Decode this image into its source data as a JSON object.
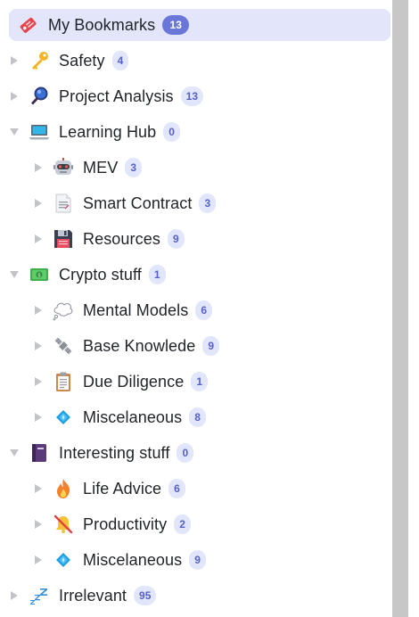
{
  "tree": {
    "root": {
      "label": "My Bookmarks",
      "count": "13",
      "icon": "bookmark-tag-icon"
    },
    "items": [
      {
        "label": "Safety",
        "count": "4",
        "icon": "key-icon",
        "level": 0,
        "state": "collapsed"
      },
      {
        "label": "Project Analysis",
        "count": "13",
        "icon": "magnifier-icon",
        "level": 0,
        "state": "collapsed"
      },
      {
        "label": "Learning Hub",
        "count": "0",
        "icon": "laptop-icon",
        "level": 0,
        "state": "expanded"
      },
      {
        "label": "MEV",
        "count": "3",
        "icon": "robot-icon",
        "level": 1,
        "state": "collapsed"
      },
      {
        "label": "Smart Contract",
        "count": "3",
        "icon": "document-icon",
        "level": 1,
        "state": "collapsed"
      },
      {
        "label": "Resources",
        "count": "9",
        "icon": "floppy-disk-icon",
        "level": 1,
        "state": "collapsed"
      },
      {
        "label": "Crypto stuff",
        "count": "1",
        "icon": "banknote-icon",
        "level": 0,
        "state": "expanded"
      },
      {
        "label": "Mental Models",
        "count": "6",
        "icon": "thought-bubble-icon",
        "level": 1,
        "state": "collapsed"
      },
      {
        "label": "Base Knowlede",
        "count": "9",
        "icon": "satellite-icon",
        "level": 1,
        "state": "collapsed"
      },
      {
        "label": "Due Diligence",
        "count": "1",
        "icon": "clipboard-icon",
        "level": 1,
        "state": "collapsed"
      },
      {
        "label": "Miscelaneous",
        "count": "8",
        "icon": "diamond-icon",
        "level": 1,
        "state": "collapsed"
      },
      {
        "label": "Interesting stuff",
        "count": "0",
        "icon": "notebook-icon",
        "level": 0,
        "state": "expanded"
      },
      {
        "label": "Life Advice",
        "count": "6",
        "icon": "fire-icon",
        "level": 1,
        "state": "collapsed"
      },
      {
        "label": "Productivity",
        "count": "2",
        "icon": "bell-slash-icon",
        "level": 1,
        "state": "collapsed"
      },
      {
        "label": "Miscelaneous",
        "count": "9",
        "icon": "diamond-icon",
        "level": 1,
        "state": "collapsed"
      },
      {
        "label": "Irrelevant",
        "count": "95",
        "icon": "zzz-icon",
        "level": 0,
        "state": "collapsed"
      }
    ]
  },
  "colors": {
    "root_bg": "#e3e6fa",
    "root_badge": "#6b76d9",
    "badge_bg": "#e2e6fb",
    "badge_text": "#5561c8",
    "caret": "#c2c4c9",
    "scrollbar": "#c7c7c7"
  }
}
